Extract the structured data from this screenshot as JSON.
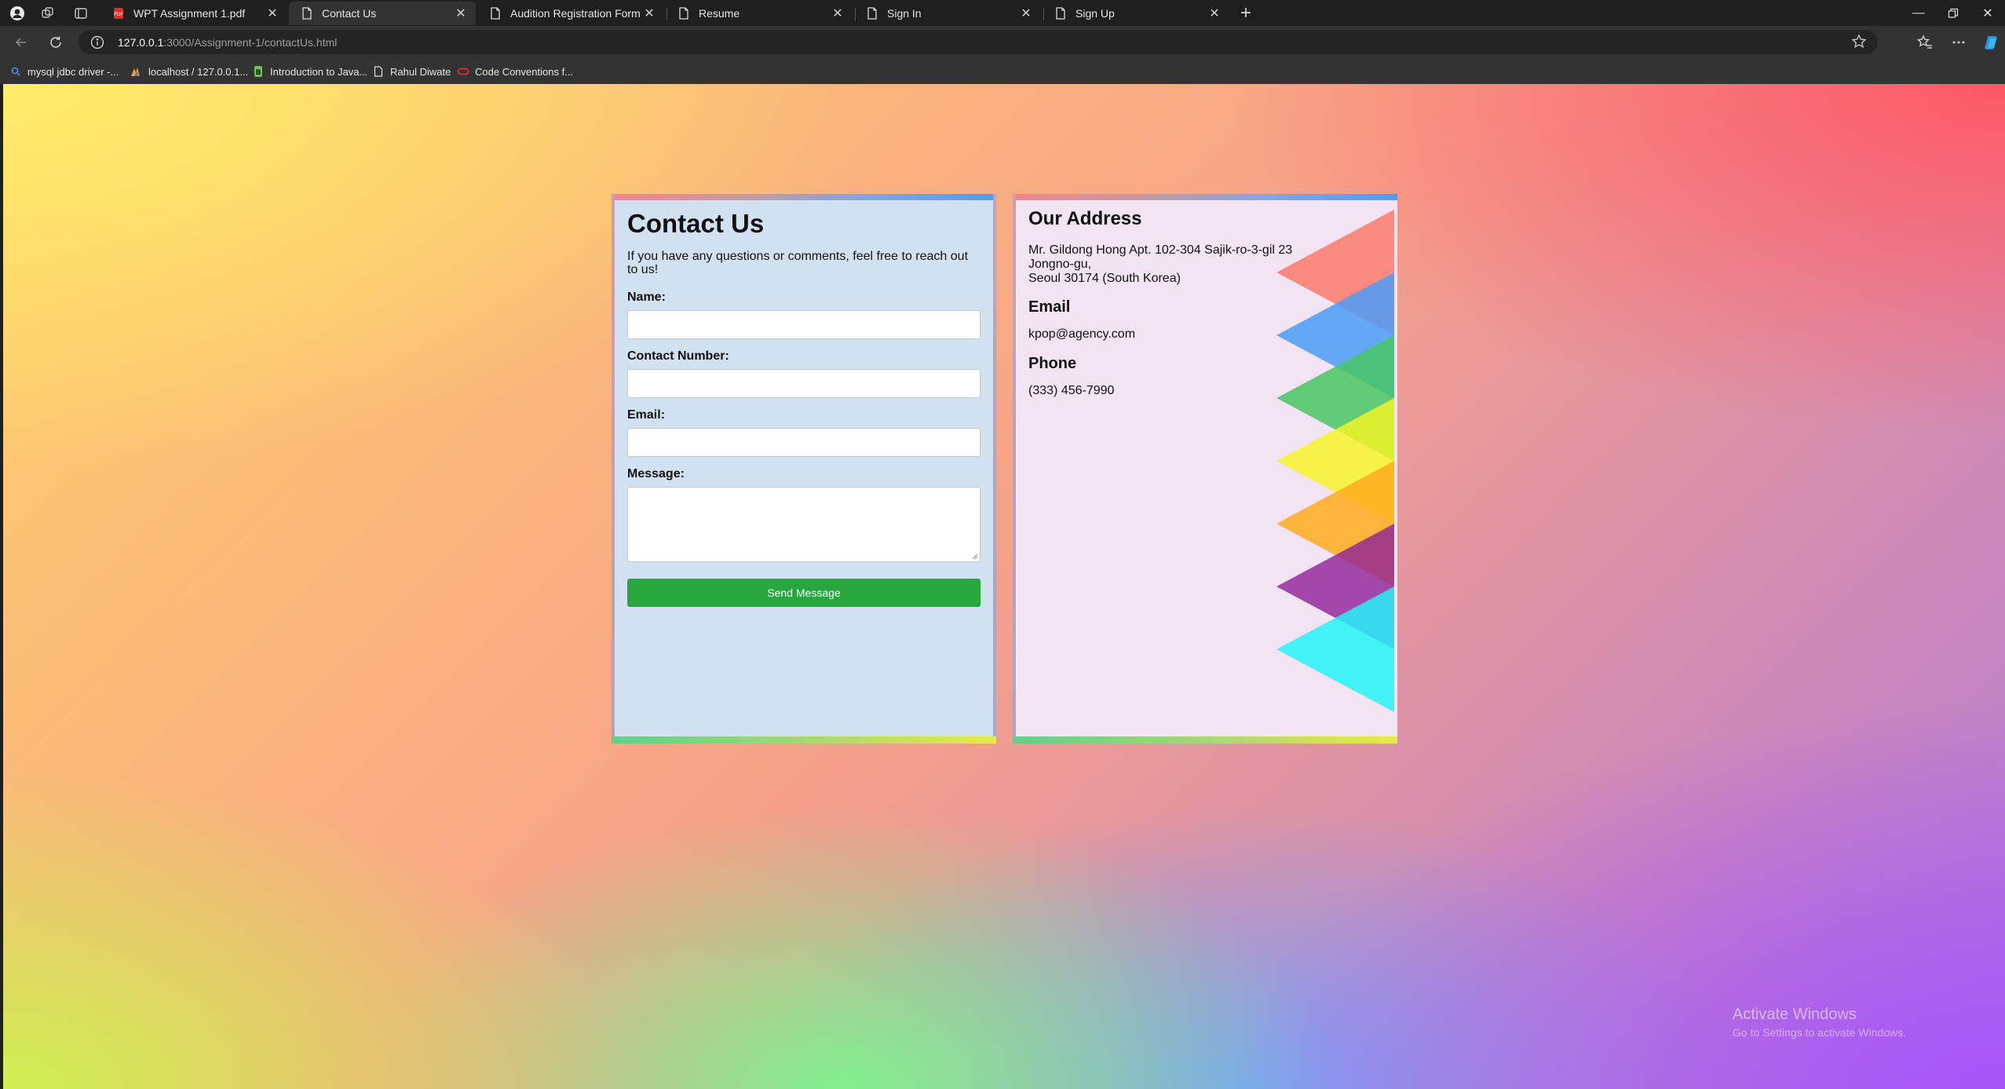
{
  "browser": {
    "tabs": [
      {
        "title": "WPT Assignment 1.pdf",
        "icon": "pdf-icon",
        "active": false
      },
      {
        "title": "Contact Us",
        "icon": "page-icon",
        "active": true
      },
      {
        "title": "Audition Registration Form",
        "icon": "page-icon",
        "active": false
      },
      {
        "title": "Resume",
        "icon": "page-icon",
        "active": false
      },
      {
        "title": "Sign In",
        "icon": "page-icon",
        "active": false
      },
      {
        "title": "Sign Up",
        "icon": "page-icon",
        "active": false
      }
    ],
    "url": {
      "host": "127.0.0.1",
      "rest": ":3000/Assignment-1/contactUs.html"
    },
    "bookmarks": [
      {
        "label": "mysql jdbc driver -...",
        "icon": "search-icon"
      },
      {
        "label": "localhost / 127.0.0.1...",
        "icon": "phpmyadmin-icon"
      },
      {
        "label": "Introduction to Java...",
        "icon": "bookmark-site-icon"
      },
      {
        "label": "Rahul Diwate",
        "icon": "page-icon"
      },
      {
        "label": "Code Conventions f...",
        "icon": "oracle-icon"
      }
    ]
  },
  "contact_form": {
    "title": "Contact Us",
    "intro": "If you have any questions or comments, feel free to reach out to us!",
    "fields": {
      "name_label": "Name:",
      "contact_label": "Contact Number:",
      "email_label": "Email:",
      "message_label": "Message:"
    },
    "values": {
      "name": "",
      "contact": "",
      "email": "",
      "message": ""
    },
    "submit_label": "Send Message"
  },
  "address_card": {
    "title": "Our Address",
    "address_lines": [
      "Mr. Gildong Hong Apt. 102-304 Sajik-ro-3-gil 23",
      "Jongno-gu,",
      "Seoul 30174 (South Korea)"
    ],
    "email_title": "Email",
    "email": "kpop@agency.com",
    "phone_title": "Phone",
    "phone": "(333) 456-7990"
  },
  "watermark": {
    "line1": "Activate Windows",
    "line2": "Go to Settings to activate Windows."
  },
  "colors": {
    "button_green": "#27a83f",
    "form_bg": "#d1e1f0",
    "address_bg": "#f2e4f2"
  }
}
